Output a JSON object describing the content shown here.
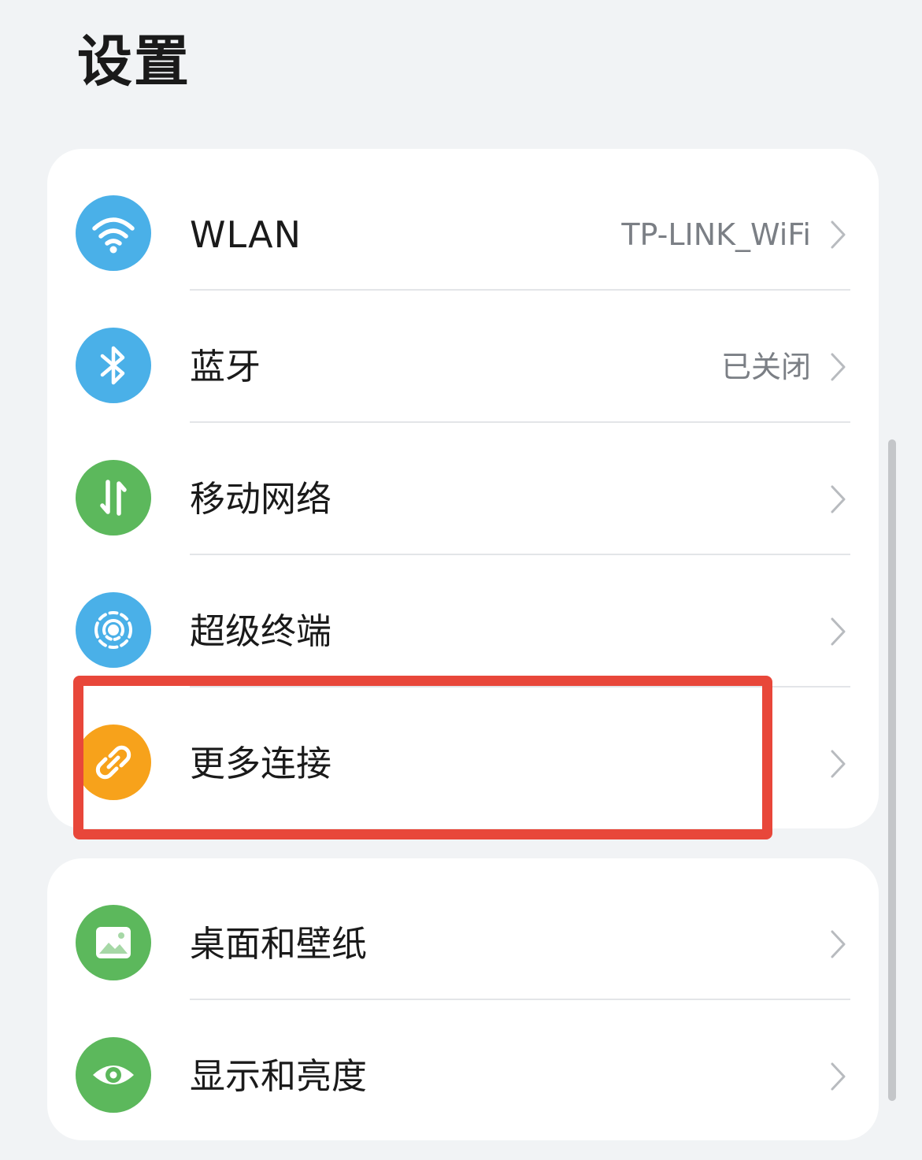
{
  "page": {
    "title": "设置"
  },
  "groups": [
    {
      "items": [
        {
          "id": "wlan",
          "label": "WLAN",
          "value": "TP-LINK_WiFi",
          "icon": "wifi-icon",
          "color": "#4ab0e8"
        },
        {
          "id": "bluetooth",
          "label": "蓝牙",
          "value": "已关闭",
          "icon": "bluetooth-icon",
          "color": "#4ab0e8"
        },
        {
          "id": "mobile-network",
          "label": "移动网络",
          "value": "",
          "icon": "mobile-data-icon",
          "color": "#5cb85c"
        },
        {
          "id": "super-device",
          "label": "超级终端",
          "value": "",
          "icon": "super-device-icon",
          "color": "#4ab0e8"
        },
        {
          "id": "more-connections",
          "label": "更多连接",
          "value": "",
          "icon": "link-icon",
          "color": "#f7a21b"
        }
      ]
    },
    {
      "items": [
        {
          "id": "home-wallpaper",
          "label": "桌面和壁纸",
          "value": "",
          "icon": "wallpaper-icon",
          "color": "#5cb85c"
        },
        {
          "id": "display-brightness",
          "label": "显示和亮度",
          "value": "",
          "icon": "eye-icon",
          "color": "#5cb85c"
        }
      ]
    }
  ],
  "annotation": {
    "highlight_color": "#e8473a",
    "highlighted_item": "more-connections"
  }
}
